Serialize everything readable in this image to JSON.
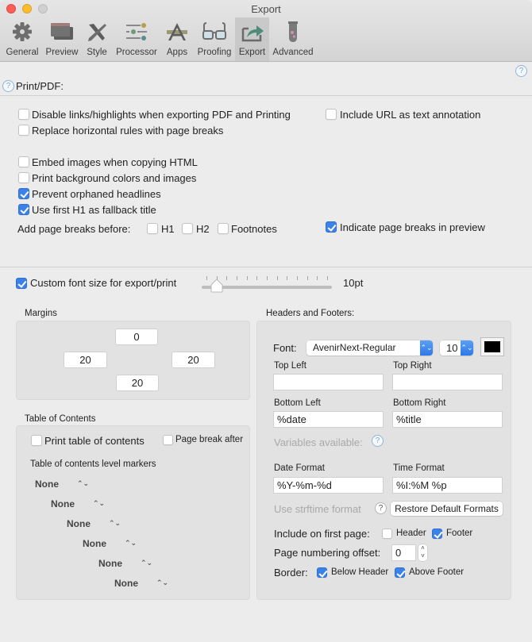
{
  "window": {
    "title": "Export"
  },
  "toolbar": {
    "items": [
      {
        "label": "General",
        "icon": "gear-icon",
        "active": false
      },
      {
        "label": "Preview",
        "icon": "preview-window-icon",
        "active": false
      },
      {
        "label": "Style",
        "icon": "brush-pencil-icon",
        "active": false
      },
      {
        "label": "Processor",
        "icon": "sliders-icon",
        "active": false
      },
      {
        "label": "Apps",
        "icon": "app-store-icon",
        "active": false
      },
      {
        "label": "Proofing",
        "icon": "glasses-icon",
        "active": false
      },
      {
        "label": "Export",
        "icon": "export-share-icon",
        "active": true
      },
      {
        "label": "Advanced",
        "icon": "test-tube-icon",
        "active": false
      }
    ]
  },
  "section": {
    "title": "Print/PDF:"
  },
  "print_options": {
    "disable_links": {
      "label": "Disable links/highlights when exporting PDF and Printing",
      "checked": false
    },
    "include_url": {
      "label": "Include URL as text annotation",
      "checked": false
    },
    "replace_rules": {
      "label": "Replace horizontal rules with page breaks",
      "checked": false
    },
    "embed_images": {
      "label": "Embed images when copying HTML",
      "checked": false
    },
    "print_background": {
      "label": "Print background colors and images",
      "checked": false
    },
    "prevent_orphans": {
      "label": "Prevent orphaned headlines",
      "checked": true
    },
    "first_h1_title": {
      "label": "Use first H1 as fallback title",
      "checked": true
    },
    "page_breaks_label": "Add page breaks before:",
    "break_h1": {
      "label": "H1",
      "checked": false
    },
    "break_h2": {
      "label": "H2",
      "checked": false
    },
    "break_footnotes": {
      "label": "Footnotes",
      "checked": false
    },
    "indicate_breaks": {
      "label": "Indicate page breaks in preview",
      "checked": true
    }
  },
  "font_size": {
    "label": "Custom font size for export/print",
    "checked": true,
    "value_label": "10pt",
    "slider_position": 1,
    "slider_steps": 12
  },
  "margins": {
    "title": "Margins",
    "top": "0",
    "left": "20",
    "right": "20",
    "bottom": "20"
  },
  "toc": {
    "title": "Table of Contents",
    "print": {
      "label": "Print table of contents",
      "checked": false
    },
    "page_break_after": {
      "label": "Page break after",
      "checked": false
    },
    "markers_label": "Table of contents level markers",
    "levels": [
      "None",
      "None",
      "None",
      "None",
      "None",
      "None"
    ]
  },
  "headers_footers": {
    "title": "Headers and Footers:",
    "font_label": "Font:",
    "font_name": "AvenirNext-Regular",
    "font_size": "10",
    "font_color": "#000000",
    "top_left_label": "Top Left",
    "top_left_value": "",
    "top_right_label": "Top Right",
    "top_right_value": "",
    "bottom_left_label": "Bottom Left",
    "bottom_left_value": "%date",
    "bottom_right_label": "Bottom Right",
    "bottom_right_value": "%title",
    "variables_label": "Variables available:",
    "date_format_label": "Date Format",
    "date_format_value": "%Y-%m-%d",
    "time_format_label": "Time Format",
    "time_format_value": "%I:%M %p",
    "strftime_label": "Use strftime format",
    "restore_button": "Restore Default Formats",
    "first_page_label": "Include on first page:",
    "first_page_header": {
      "label": "Header",
      "checked": false
    },
    "first_page_footer": {
      "label": "Footer",
      "checked": true
    },
    "page_offset_label": "Page numbering offset:",
    "page_offset_value": "0",
    "border_label": "Border:",
    "border_below_header": {
      "label": "Below Header",
      "checked": true
    },
    "border_above_footer": {
      "label": "Above Footer",
      "checked": true
    }
  },
  "icons": {
    "help": "?",
    "popup_arrows": "⌃⌄",
    "stepper_up": "˄",
    "stepper_down": "˅"
  }
}
